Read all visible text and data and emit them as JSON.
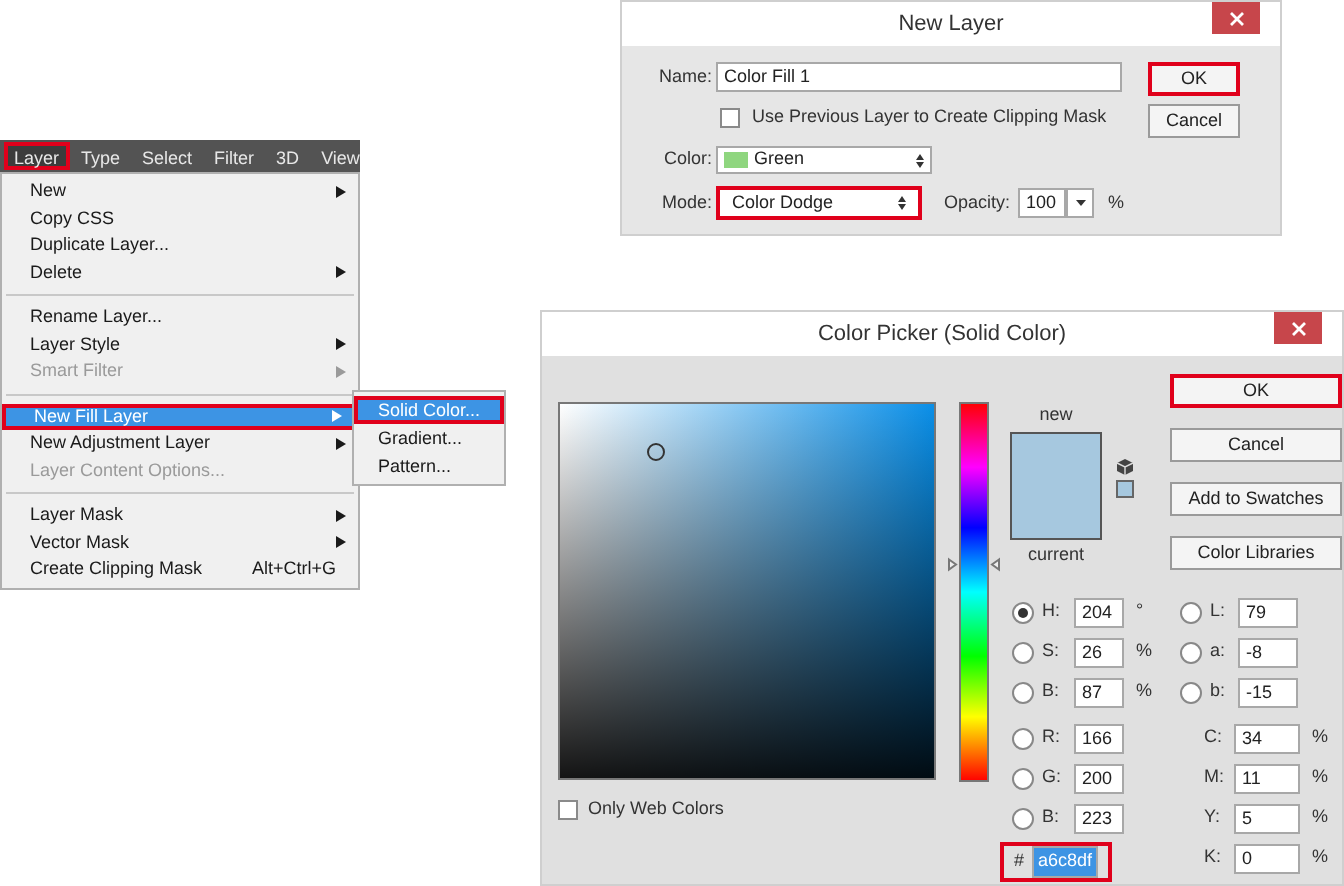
{
  "layer_menu": {
    "menubar": [
      {
        "label": "Layer",
        "selected": true,
        "outlined": true
      },
      {
        "label": "Type",
        "selected": false,
        "outlined": false
      },
      {
        "label": "Select",
        "selected": false,
        "outlined": false
      },
      {
        "label": "Filter",
        "selected": false,
        "outlined": false
      },
      {
        "label": "3D",
        "selected": false,
        "outlined": false
      },
      {
        "label": "View",
        "selected": false,
        "outlined": false
      }
    ],
    "groups": [
      [
        {
          "label": "New",
          "submenu": true,
          "disabled": false,
          "selected": false,
          "outlined": false
        },
        {
          "label": "Copy CSS",
          "submenu": false,
          "disabled": false,
          "selected": false,
          "outlined": false
        },
        {
          "label": "Duplicate Layer...",
          "submenu": false,
          "disabled": false,
          "selected": false,
          "outlined": false
        },
        {
          "label": "Delete",
          "submenu": true,
          "disabled": false,
          "selected": false,
          "outlined": false
        }
      ],
      [
        {
          "label": "Rename Layer...",
          "submenu": false,
          "disabled": false,
          "selected": false,
          "outlined": false
        },
        {
          "label": "Layer Style",
          "submenu": true,
          "disabled": false,
          "selected": false,
          "outlined": false
        },
        {
          "label": "Smart Filter",
          "submenu": true,
          "disabled": true,
          "selected": false,
          "outlined": false
        }
      ],
      [
        {
          "label": "New Fill Layer",
          "submenu": true,
          "disabled": false,
          "selected": true,
          "outlined": true
        },
        {
          "label": "New Adjustment Layer",
          "submenu": true,
          "disabled": false,
          "selected": false,
          "outlined": false
        },
        {
          "label": "Layer Content Options...",
          "submenu": false,
          "disabled": true,
          "selected": false,
          "outlined": false
        }
      ],
      [
        {
          "label": "Layer Mask",
          "submenu": true,
          "disabled": false,
          "selected": false,
          "outlined": false
        },
        {
          "label": "Vector Mask",
          "submenu": true,
          "disabled": false,
          "selected": false,
          "outlined": false
        },
        {
          "label": "Create Clipping Mask",
          "shortcut": "Alt+Ctrl+G",
          "submenu": false,
          "disabled": false,
          "selected": false,
          "outlined": false
        }
      ]
    ],
    "submenu": [
      {
        "label": "Solid Color...",
        "selected": true,
        "outlined": true
      },
      {
        "label": "Gradient...",
        "selected": false,
        "outlined": false
      },
      {
        "label": "Pattern...",
        "selected": false,
        "outlined": false
      }
    ]
  },
  "new_layer": {
    "title": "New Layer",
    "name": {
      "label": "Name:",
      "value": "Color Fill 1"
    },
    "clipping_mask": {
      "label": "Use Previous Layer to Create Clipping Mask",
      "checked": false
    },
    "color": {
      "label": "Color:",
      "value": "Green",
      "color": "#8fd67f"
    },
    "mode": {
      "label": "Mode:",
      "value": "Color Dodge",
      "outlined": true
    },
    "opacity": {
      "label": "Opacity:",
      "value": "100",
      "unit": "%"
    },
    "buttons": [
      {
        "label": "OK",
        "outlined": true
      },
      {
        "label": "Cancel",
        "outlined": false
      }
    ]
  },
  "color_picker": {
    "title": "Color Picker (Solid Color)",
    "new_label": "new",
    "current_label": "current",
    "hue_slider": {
      "level": 0.57
    },
    "buttons": [
      {
        "label": "OK",
        "outlined": true
      },
      {
        "label": "Cancel",
        "outlined": false
      },
      {
        "label": "Add to Swatches",
        "outlined": false
      },
      {
        "label": "Color Libraries",
        "outlined": false
      }
    ],
    "left_fields": [
      {
        "label": "H:",
        "value": "204",
        "unit": "°",
        "selected": true
      },
      {
        "label": "S:",
        "value": "26",
        "unit": "%",
        "selected": false
      },
      {
        "label": "B:",
        "value": "87",
        "unit": "%",
        "selected": false
      },
      {
        "label": "R:",
        "value": "166",
        "selected": false
      },
      {
        "label": "G:",
        "value": "200",
        "selected": false
      },
      {
        "label": "B:",
        "value": "223",
        "selected": false
      }
    ],
    "lab_fields": [
      {
        "label": "L:",
        "value": "79",
        "selected": false
      },
      {
        "label": "a:",
        "value": "-8",
        "selected": false
      },
      {
        "label": "b:",
        "value": "-15",
        "selected": false
      }
    ],
    "cmyk_fields": [
      {
        "label": "C:",
        "value": "34",
        "unit": "%"
      },
      {
        "label": "M:",
        "value": "11",
        "unit": "%"
      },
      {
        "label": "Y:",
        "value": "5",
        "unit": "%"
      },
      {
        "label": "K:",
        "value": "0",
        "unit": "%"
      }
    ],
    "hex": {
      "label": "#",
      "value": "a6c8df",
      "outlined": true
    },
    "web_colors": {
      "label": "Only Web Colors",
      "checked": false
    }
  }
}
